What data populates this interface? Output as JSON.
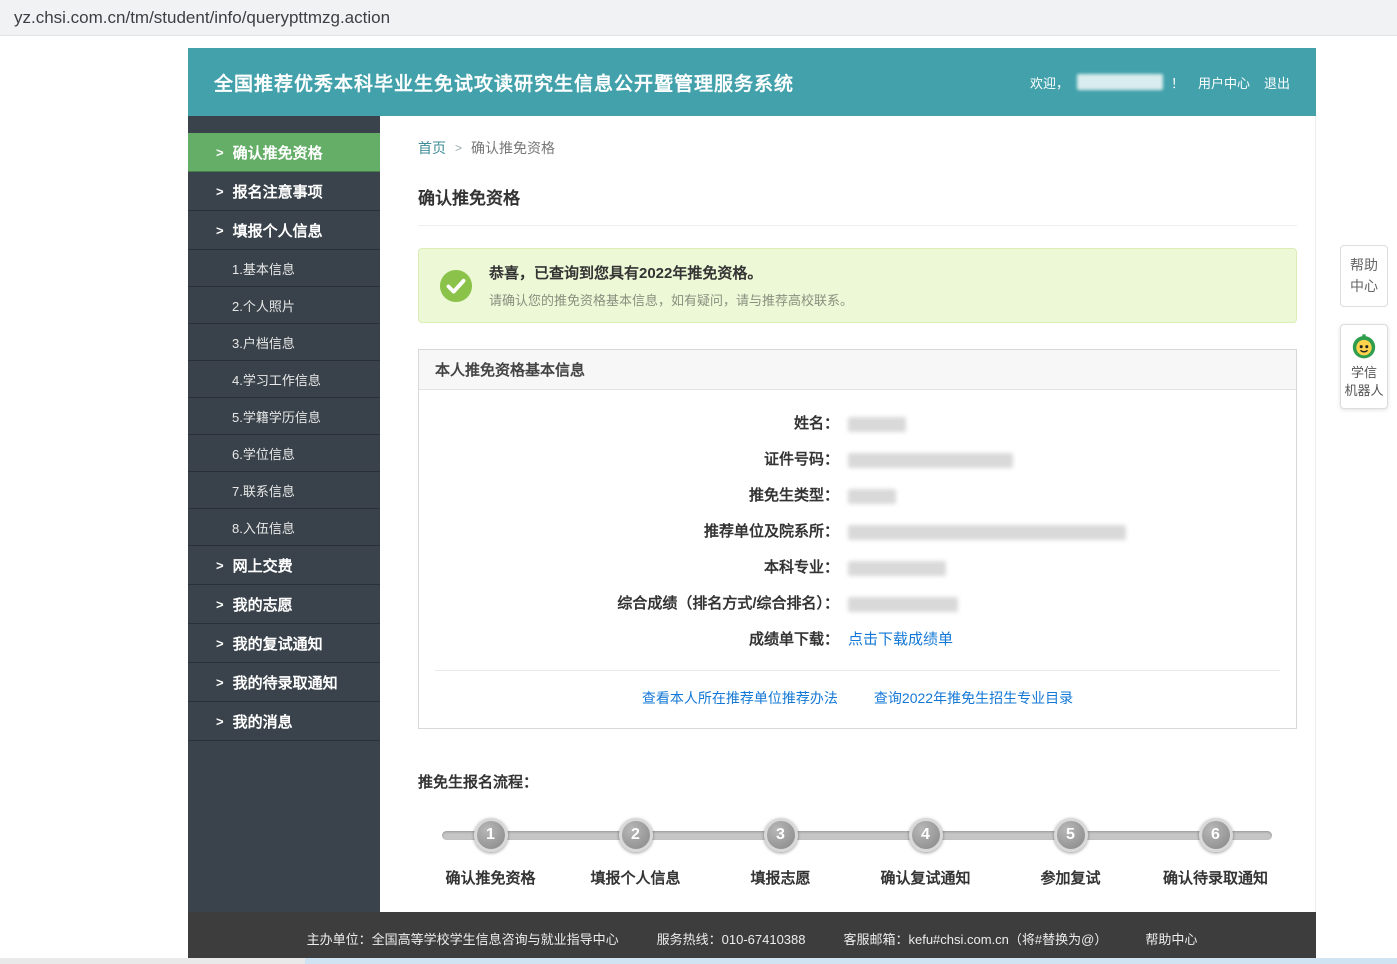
{
  "browser": {
    "url": "yz.chsi.com.cn/tm/student/info/querypttmzg.action"
  },
  "header": {
    "title": "全国推荐优秀本科毕业生免试攻读研究生信息公开暨管理服务系统",
    "welcome_prefix": "欢迎，",
    "welcome_suffix": "！",
    "user_center": "用户中心",
    "logout": "退出"
  },
  "sidebar": {
    "arrow": ">",
    "items": [
      {
        "label": "确认推免资格",
        "type": "main",
        "active": true
      },
      {
        "label": "报名注意事项",
        "type": "main"
      },
      {
        "label": "填报个人信息",
        "type": "main"
      },
      {
        "label": "1.基本信息",
        "type": "sub"
      },
      {
        "label": "2.个人照片",
        "type": "sub"
      },
      {
        "label": "3.户档信息",
        "type": "sub"
      },
      {
        "label": "4.学习工作信息",
        "type": "sub"
      },
      {
        "label": "5.学籍学历信息",
        "type": "sub"
      },
      {
        "label": "6.学位信息",
        "type": "sub"
      },
      {
        "label": "7.联系信息",
        "type": "sub"
      },
      {
        "label": "8.入伍信息",
        "type": "sub"
      },
      {
        "label": "网上交费",
        "type": "main"
      },
      {
        "label": "我的志愿",
        "type": "main"
      },
      {
        "label": "我的复试通知",
        "type": "main"
      },
      {
        "label": "我的待录取通知",
        "type": "main"
      },
      {
        "label": "我的消息",
        "type": "main"
      }
    ]
  },
  "breadcrumb": {
    "home": "首页",
    "separator": ">",
    "current": "确认推免资格"
  },
  "page": {
    "title": "确认推免资格"
  },
  "alert": {
    "title": "恭喜，已查询到您具有2022年推免资格。",
    "subtitle": "请确认您的推免资格基本信息，如有疑问，请与推荐高校联系。"
  },
  "info_panel": {
    "title": "本人推免资格基本信息",
    "fields": [
      {
        "label": "姓名："
      },
      {
        "label": "证件号码："
      },
      {
        "label": "推免生类型："
      },
      {
        "label": "推荐单位及院系所："
      },
      {
        "label": "本科专业："
      },
      {
        "label": "综合成绩（排名方式/综合排名）："
      },
      {
        "label": "成绩单下载：",
        "link": "点击下载成绩单"
      }
    ],
    "links": [
      "查看本人所在推荐单位推荐办法",
      "查询2022年推免生招生专业目录"
    ]
  },
  "flow": {
    "title": "推免生报名流程：",
    "steps": [
      {
        "num": "1",
        "label": "确认推免资格"
      },
      {
        "num": "2",
        "label": "填报个人信息"
      },
      {
        "num": "3",
        "label": "填报志愿"
      },
      {
        "num": "4",
        "label": "确认复试通知"
      },
      {
        "num": "5",
        "label": "参加复试"
      },
      {
        "num": "6",
        "label": "确认待录取通知"
      }
    ]
  },
  "floating": {
    "help": [
      "帮助",
      "中心"
    ],
    "robot": [
      "学信",
      "机器人"
    ]
  },
  "footer": {
    "organizer": "主办单位：全国高等学校学生信息咨询与就业指导中心",
    "hotline": "服务热线：010-67410388",
    "email": "客服邮箱：kefu#chsi.com.cn（将#替换为@）",
    "help_center": "帮助中心"
  },
  "colors": {
    "header_teal": "#42a1ab",
    "sidebar_dark": "#3a434b",
    "active_green": "#65ae68",
    "alert_bg": "#edf8d7",
    "check_green": "#8bc34a",
    "link_blue": "#1478d6",
    "footer_dark": "#3d3d3d"
  }
}
